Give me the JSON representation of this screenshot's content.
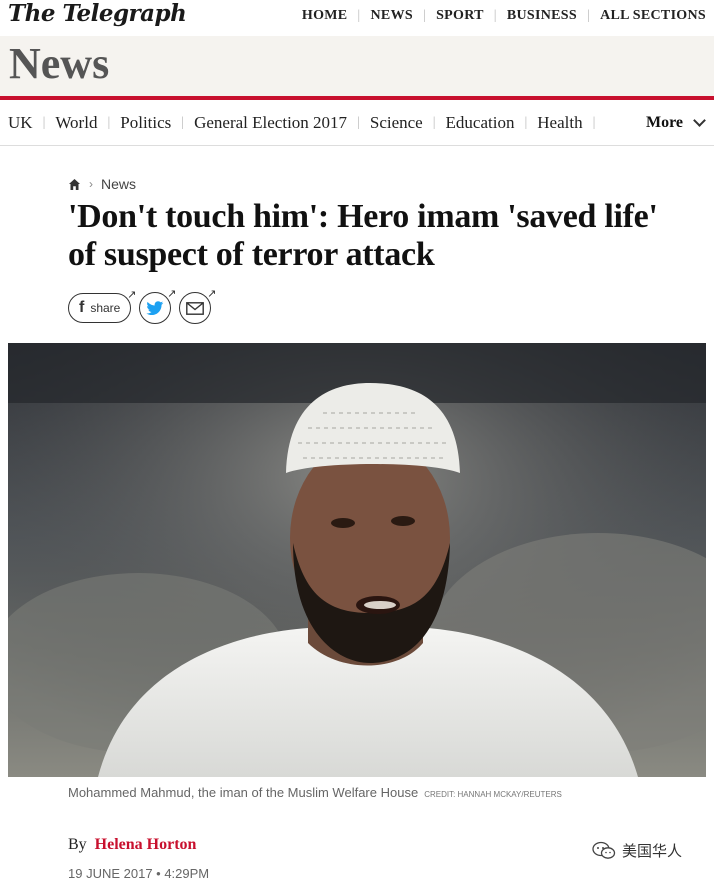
{
  "header": {
    "logo": "The Telegraph",
    "topnav": [
      "HOME",
      "NEWS",
      "SPORT",
      "BUSINESS",
      "ALL SECTIONS"
    ]
  },
  "section": {
    "title": "News"
  },
  "subnav": {
    "items": [
      "UK",
      "World",
      "Politics",
      "General Election 2017",
      "Science",
      "Education",
      "Health"
    ],
    "more": "More"
  },
  "article": {
    "breadcrumb": "News",
    "headline": "'Don't touch him': Hero imam 'saved life' of suspect of terror attack",
    "share_label": "share",
    "caption": "Mohammed Mahmud, the iman of the Muslim Welfare House",
    "credit": "CREDIT: HANNAH MCKAY/REUTERS",
    "byline_prefix": "By",
    "author": "Helena Horton",
    "date": "19 JUNE 2017 • 4:29PM"
  },
  "watermark": {
    "text": "美国华人"
  },
  "icons": {
    "breadcrumb_home": "home-icon",
    "facebook": "facebook-icon",
    "twitter": "twitter-icon",
    "email": "email-icon",
    "more_chevron": "chevron-down-icon",
    "watermark": "wechat-icon"
  },
  "colors": {
    "accent": "#c8102e",
    "twitter": "#1da1f2"
  }
}
